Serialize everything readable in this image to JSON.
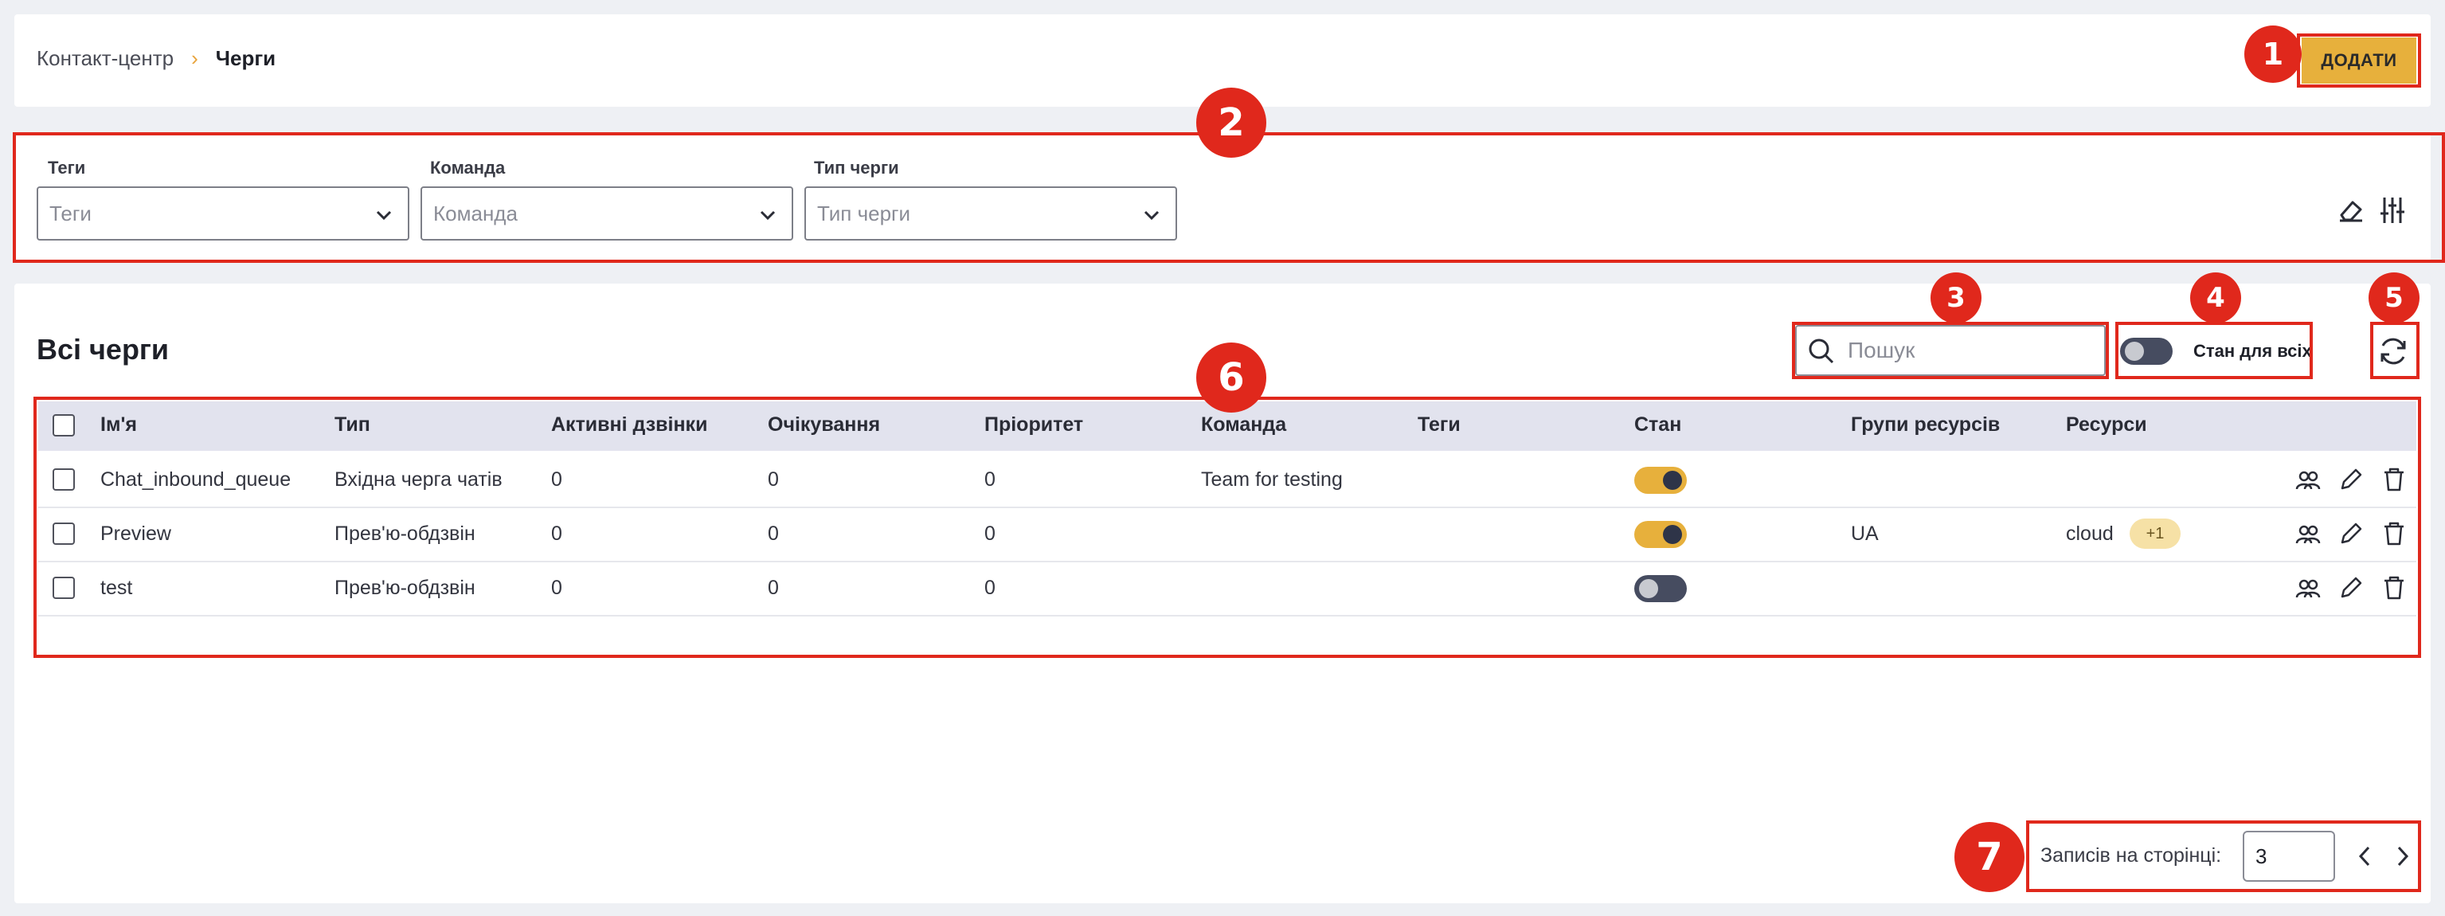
{
  "breadcrumb": {
    "parent": "Контакт-центр",
    "separator": "›",
    "current": "Черги"
  },
  "header": {
    "add_label": "ДОДАТИ"
  },
  "filters": [
    {
      "label": "Теги",
      "placeholder": "Теги"
    },
    {
      "label": "Команда",
      "placeholder": "Команда"
    },
    {
      "label": "Тип черги",
      "placeholder": "Тип черги"
    }
  ],
  "filter_icons": [
    "eraser-icon",
    "sliders-icon"
  ],
  "section": {
    "title": "Всі черги"
  },
  "search": {
    "placeholder": "Пошук"
  },
  "state_all": {
    "label": "Стан для всіх",
    "on": false
  },
  "table": {
    "columns": [
      "Ім'я",
      "Тип",
      "Активні дзвінки",
      "Очікування",
      "Пріоритет",
      "Команда",
      "Теги",
      "Стан",
      "Групи ресурсів",
      "Ресурси"
    ],
    "rows": [
      {
        "name": "Chat_inbound_queue",
        "type": "Вхідна черга чатів",
        "active": "0",
        "waiting": "0",
        "priority": "0",
        "team": "Team for testing",
        "tags": "",
        "state": true,
        "groups": "",
        "resources": "",
        "extra": ""
      },
      {
        "name": "Preview",
        "type": "Прев'ю-обдзвін",
        "active": "0",
        "waiting": "0",
        "priority": "0",
        "team": "",
        "tags": "",
        "state": true,
        "groups": "UA",
        "resources": "cloud",
        "extra": "+1"
      },
      {
        "name": "test",
        "type": "Прев'ю-обдзвін",
        "active": "0",
        "waiting": "0",
        "priority": "0",
        "team": "",
        "tags": "",
        "state": false,
        "groups": "",
        "resources": "",
        "extra": ""
      }
    ],
    "row_actions": [
      "users-icon",
      "edit-icon",
      "delete-icon"
    ]
  },
  "pagination": {
    "label": "Записів на сторінці:",
    "value": "3"
  },
  "annotations": [
    "1",
    "2",
    "3",
    "4",
    "5",
    "6",
    "7"
  ],
  "colors": {
    "accent": "#e7b03c",
    "annotation": "#e0281c",
    "toggle_off": "#464c60",
    "header_bg": "#e2e3ee"
  }
}
